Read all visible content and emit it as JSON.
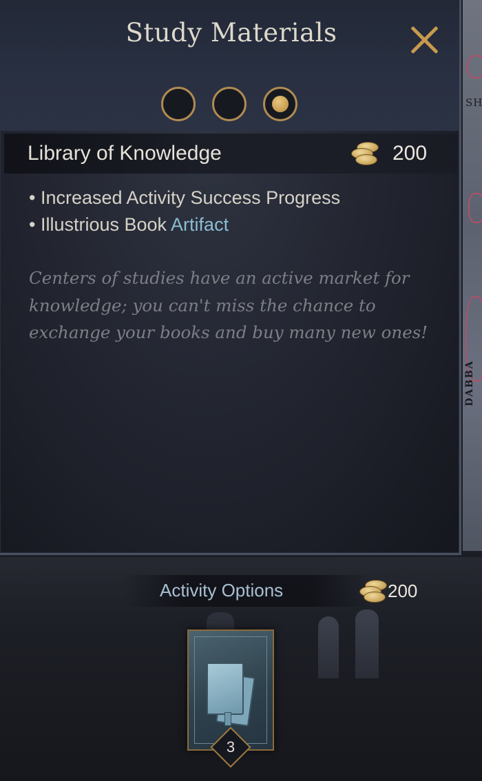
{
  "map": {
    "label_top": "SH",
    "label_side": "DABBA"
  },
  "panel": {
    "title": "Study Materials",
    "close_icon": "close-icon",
    "option_pages": 3,
    "active_page": 3,
    "option": {
      "name": "Library of Knowledge",
      "cost": "200",
      "cost_icon": "gold-coins-icon",
      "effects": [
        {
          "text": "• Increased Activity Success Progress",
          "link": ""
        },
        {
          "text": "• Illustrious Book ",
          "link": "Artifact"
        }
      ],
      "flavor": "Centers of studies have an active market for knowledge; you can't miss the chance to exchange your books and buy many new ones!"
    }
  },
  "bottom": {
    "options_label": "Activity Options",
    "options_cost": "200",
    "cost_icon": "gold-coins-icon",
    "card": {
      "icon": "book-icon",
      "badge": "3"
    }
  },
  "colors": {
    "gold_accent": "#c79a4e",
    "link_blue": "#8bbcd1",
    "flavor_gray": "#7d7f86"
  }
}
